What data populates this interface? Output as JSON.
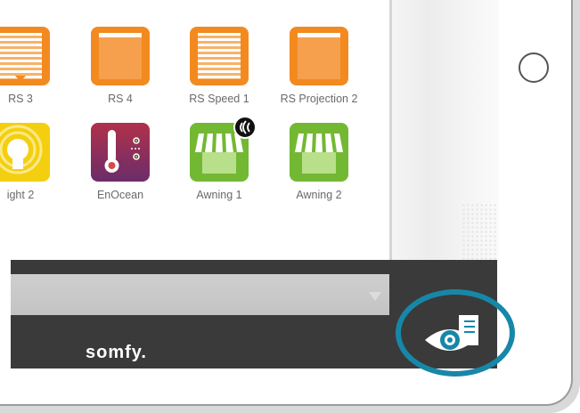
{
  "device": {
    "brand": "somfy."
  },
  "tiles_row1": [
    {
      "label": "RS 3",
      "style": "slats",
      "color": "#f28a20"
    },
    {
      "label": "RS 4",
      "style": "panel",
      "color": "#f28a20"
    },
    {
      "label": "RS Speed 1",
      "style": "slats",
      "color": "#f28a20"
    },
    {
      "label": "RS Projection 2",
      "style": "panel",
      "color": "#f28a20"
    }
  ],
  "tiles_row2": [
    {
      "label": "ight 2",
      "style": "light",
      "color": "#f4cf10"
    },
    {
      "label": "EnOcean",
      "style": "thermometer",
      "color": "#8a2f5a"
    },
    {
      "label": "Awning 1",
      "style": "awning",
      "color": "#73b833",
      "badge": "radio-signal-icon"
    },
    {
      "label": "Awning 2",
      "style": "awning",
      "color": "#73b833"
    }
  ],
  "colors": {
    "accent_ring": "#1787a8",
    "dark_band": "#3a3a3a",
    "gray_bar": "#c8c8c8"
  }
}
